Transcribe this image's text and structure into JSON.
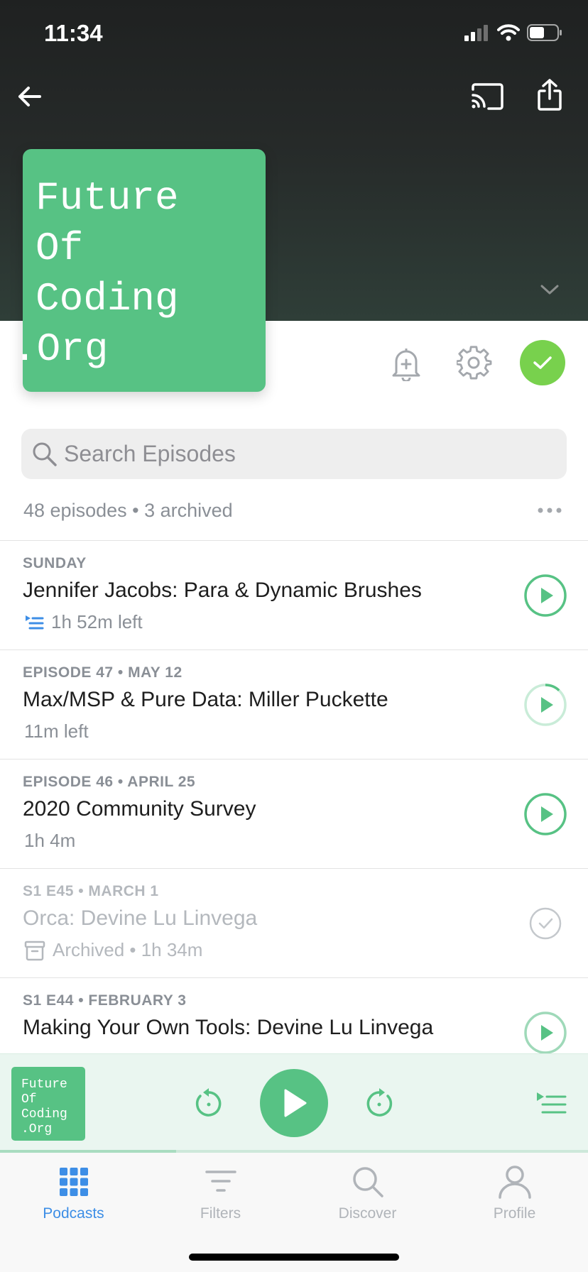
{
  "status_bar": {
    "time": "11:34"
  },
  "podcast": {
    "artwork_lines": [
      "Future",
      "Of",
      "Coding",
      ".Org"
    ]
  },
  "search": {
    "placeholder": "Search Episodes"
  },
  "summary": {
    "episodes": "48 episodes",
    "archived": "3 archived"
  },
  "episodes": [
    {
      "meta": "SUNDAY",
      "title": "Jennifer Jacobs: Para & Dynamic Brushes",
      "status": "1h 52m left",
      "state": "up-next"
    },
    {
      "meta": "EPISODE 47 • MAY 12",
      "title": "Max/MSP & Pure Data: Miller Puckette",
      "status": "11m left",
      "state": "in-progress",
      "played_fraction": 0.12
    },
    {
      "meta": "EPISODE 46 • APRIL 25",
      "title": "2020 Community Survey",
      "status": "1h 4m",
      "state": "unplayed"
    },
    {
      "meta": "S1 E45 • MARCH 1",
      "title": "Orca: Devine Lu Linvega",
      "status": "Archived • 1h 34m",
      "state": "archived"
    },
    {
      "meta": "S1 E44 • FEBRUARY 3",
      "title": "Making Your Own Tools: Devine Lu Linvega",
      "status": "",
      "state": "unplayed"
    }
  ],
  "mini_player": {
    "artwork_text": "Future\nOf\nCoding\n.Org",
    "progress_fraction": 0.3
  },
  "tabs": [
    {
      "label": "Podcasts",
      "icon": "grid-icon",
      "active": true
    },
    {
      "label": "Filters",
      "icon": "filter-icon",
      "active": false
    },
    {
      "label": "Discover",
      "icon": "search-icon",
      "active": false
    },
    {
      "label": "Profile",
      "icon": "profile-icon",
      "active": false
    }
  ],
  "colors": {
    "accent_green": "#57c284",
    "subscribed_green": "#78d14d",
    "tab_active_blue": "#3d8ee6",
    "header_dark": "#1f2121"
  }
}
